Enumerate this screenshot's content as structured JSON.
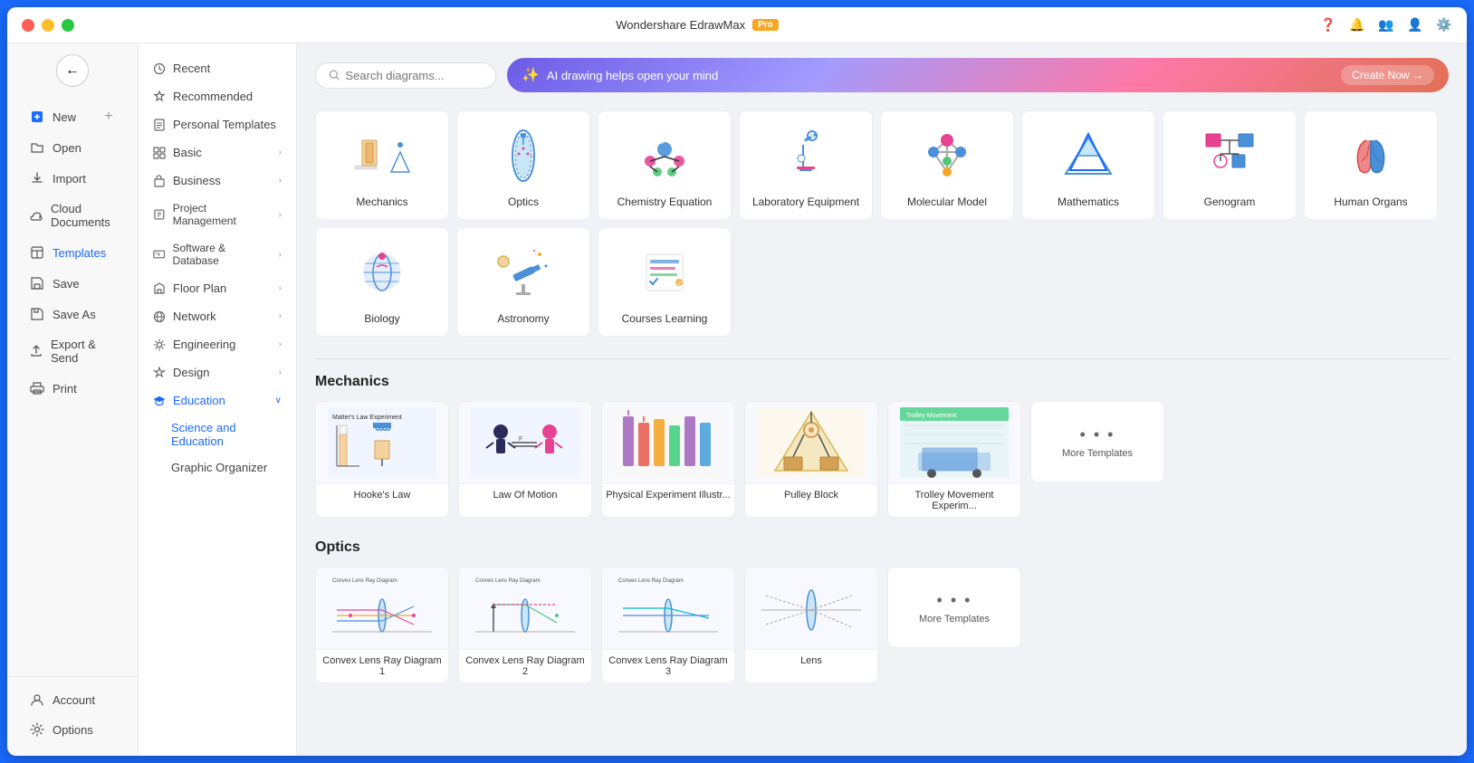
{
  "app": {
    "title": "Wondershare EdrawMax",
    "pro_badge": "Pro"
  },
  "titlebar": {
    "min": "−",
    "max": "□",
    "close": "×"
  },
  "left_nav": {
    "back_label": "←",
    "items": [
      {
        "id": "new",
        "icon": "➕",
        "label": "New",
        "has_add": true
      },
      {
        "id": "open",
        "icon": "📁",
        "label": "Open",
        "has_add": false
      },
      {
        "id": "import",
        "icon": "📥",
        "label": "Import",
        "has_add": false
      },
      {
        "id": "cloud",
        "icon": "☁️",
        "label": "Cloud Documents",
        "has_add": false
      },
      {
        "id": "templates",
        "icon": "🗒",
        "label": "Templates",
        "has_add": false
      },
      {
        "id": "save",
        "icon": "💾",
        "label": "Save",
        "has_add": false
      },
      {
        "id": "saveas",
        "icon": "💾",
        "label": "Save As",
        "has_add": false
      },
      {
        "id": "export",
        "icon": "📤",
        "label": "Export & Send",
        "has_add": false
      },
      {
        "id": "print",
        "icon": "🖨",
        "label": "Print",
        "has_add": false
      }
    ],
    "bottom": [
      {
        "id": "account",
        "icon": "👤",
        "label": "Account"
      },
      {
        "id": "options",
        "icon": "⚙️",
        "label": "Options"
      }
    ]
  },
  "middle_nav": {
    "items": [
      {
        "id": "recent",
        "icon": "🕐",
        "label": "Recent",
        "sub": false
      },
      {
        "id": "recommended",
        "icon": "⭐",
        "label": "Recommended",
        "sub": false
      },
      {
        "id": "personal",
        "icon": "📄",
        "label": "Personal Templates",
        "sub": false
      },
      {
        "id": "basic",
        "icon": "◇",
        "label": "Basic",
        "sub": false,
        "chevron": true
      },
      {
        "id": "business",
        "icon": "💼",
        "label": "Business",
        "sub": false,
        "chevron": true
      },
      {
        "id": "project",
        "icon": "📋",
        "label": "Project Management",
        "sub": false,
        "chevron": true
      },
      {
        "id": "software",
        "icon": "🖥",
        "label": "Software & Database",
        "sub": false,
        "chevron": true
      },
      {
        "id": "floor",
        "icon": "🏠",
        "label": "Floor Plan",
        "sub": false,
        "chevron": true
      },
      {
        "id": "network",
        "icon": "🌐",
        "label": "Network",
        "sub": false,
        "chevron": true
      },
      {
        "id": "engineering",
        "icon": "⚙",
        "label": "Engineering",
        "sub": false,
        "chevron": true
      },
      {
        "id": "design",
        "icon": "🎨",
        "label": "Design",
        "sub": false,
        "chevron": true
      },
      {
        "id": "education",
        "icon": "🎓",
        "label": "Education",
        "sub": false,
        "chevron": true,
        "active": true
      },
      {
        "id": "science",
        "label": "Science and Education",
        "subitem": true,
        "active": true
      },
      {
        "id": "graphic",
        "label": "Graphic Organizer",
        "subitem": true
      }
    ]
  },
  "search": {
    "placeholder": "Search diagrams..."
  },
  "ai_banner": {
    "icon": "✨",
    "text": "AI drawing helps open your mind",
    "btn_label": "Create Now →"
  },
  "categories": [
    {
      "id": "mechanics",
      "label": "Mechanics"
    },
    {
      "id": "optics",
      "label": "Optics"
    },
    {
      "id": "chemistry",
      "label": "Chemistry Equation"
    },
    {
      "id": "lab",
      "label": "Laboratory Equipment"
    },
    {
      "id": "molecular",
      "label": "Molecular Model"
    },
    {
      "id": "mathematics",
      "label": "Mathematics"
    },
    {
      "id": "genogram",
      "label": "Genogram"
    },
    {
      "id": "human-organs",
      "label": "Human Organs"
    },
    {
      "id": "biology",
      "label": "Biology"
    },
    {
      "id": "astronomy",
      "label": "Astronomy"
    },
    {
      "id": "courses",
      "label": "Courses Learning"
    }
  ],
  "mechanics_section": {
    "title": "Mechanics",
    "templates": [
      {
        "id": "hookes",
        "label": "Hooke's Law"
      },
      {
        "id": "law-motion",
        "label": "Law Of Motion"
      },
      {
        "id": "physical",
        "label": "Physical Experiment Illustr..."
      },
      {
        "id": "pulley",
        "label": "Pulley Block"
      },
      {
        "id": "trolley",
        "label": "Trolley Movement Experim..."
      }
    ],
    "more_label": "More Templates"
  },
  "optics_section": {
    "title": "Optics",
    "templates": [
      {
        "id": "convex1",
        "label": "Convex Lens Ray Diagram 1"
      },
      {
        "id": "convex2",
        "label": "Convex Lens Ray Diagram 2"
      },
      {
        "id": "convex3",
        "label": "Convex Lens Ray Diagram 3"
      },
      {
        "id": "lens",
        "label": "Lens"
      }
    ],
    "more_label": "More Templates"
  }
}
